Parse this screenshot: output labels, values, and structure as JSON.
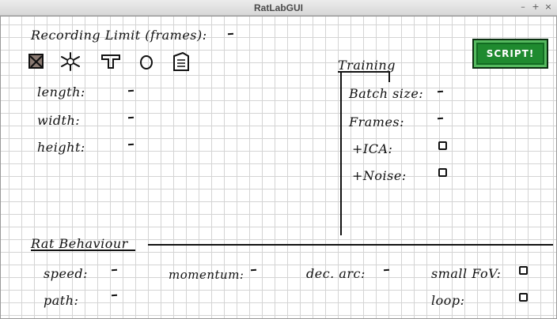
{
  "window": {
    "title": "RatLabGUI"
  },
  "header": {
    "recording_limit_label": "Recording Limit (frames):",
    "recording_limit_value": "-"
  },
  "shapes": [
    "checked-box-icon",
    "asterisk-icon",
    "t-shape-icon",
    "circle-icon",
    "document-icon"
  ],
  "dimensions": {
    "length_label": "length:",
    "length_value": "-",
    "width_label": "width:",
    "width_value": "-",
    "height_label": "height:",
    "height_value": "-"
  },
  "training": {
    "title": "Training",
    "batch_size_label": "Batch size:",
    "batch_size_value": "-",
    "frames_label": "Frames:",
    "frames_value": "-",
    "ica_label": "+ICA:",
    "noise_label": "+Noise:"
  },
  "script_button": {
    "label": "SCRIPT!"
  },
  "behaviour": {
    "title": "Rat Behaviour",
    "speed_label": "speed:",
    "speed_value": "-",
    "momentum_label": "momentum:",
    "momentum_value": "-",
    "dec_arc_label": "dec. arc:",
    "dec_arc_value": "-",
    "small_fov_label": "small FoV:",
    "path_label": "path:",
    "path_value": "-",
    "loop_label": "loop:"
  },
  "colors": {
    "button_green": "#1f8a2f",
    "grid": "#d4d4d4",
    "ink": "#111111"
  }
}
